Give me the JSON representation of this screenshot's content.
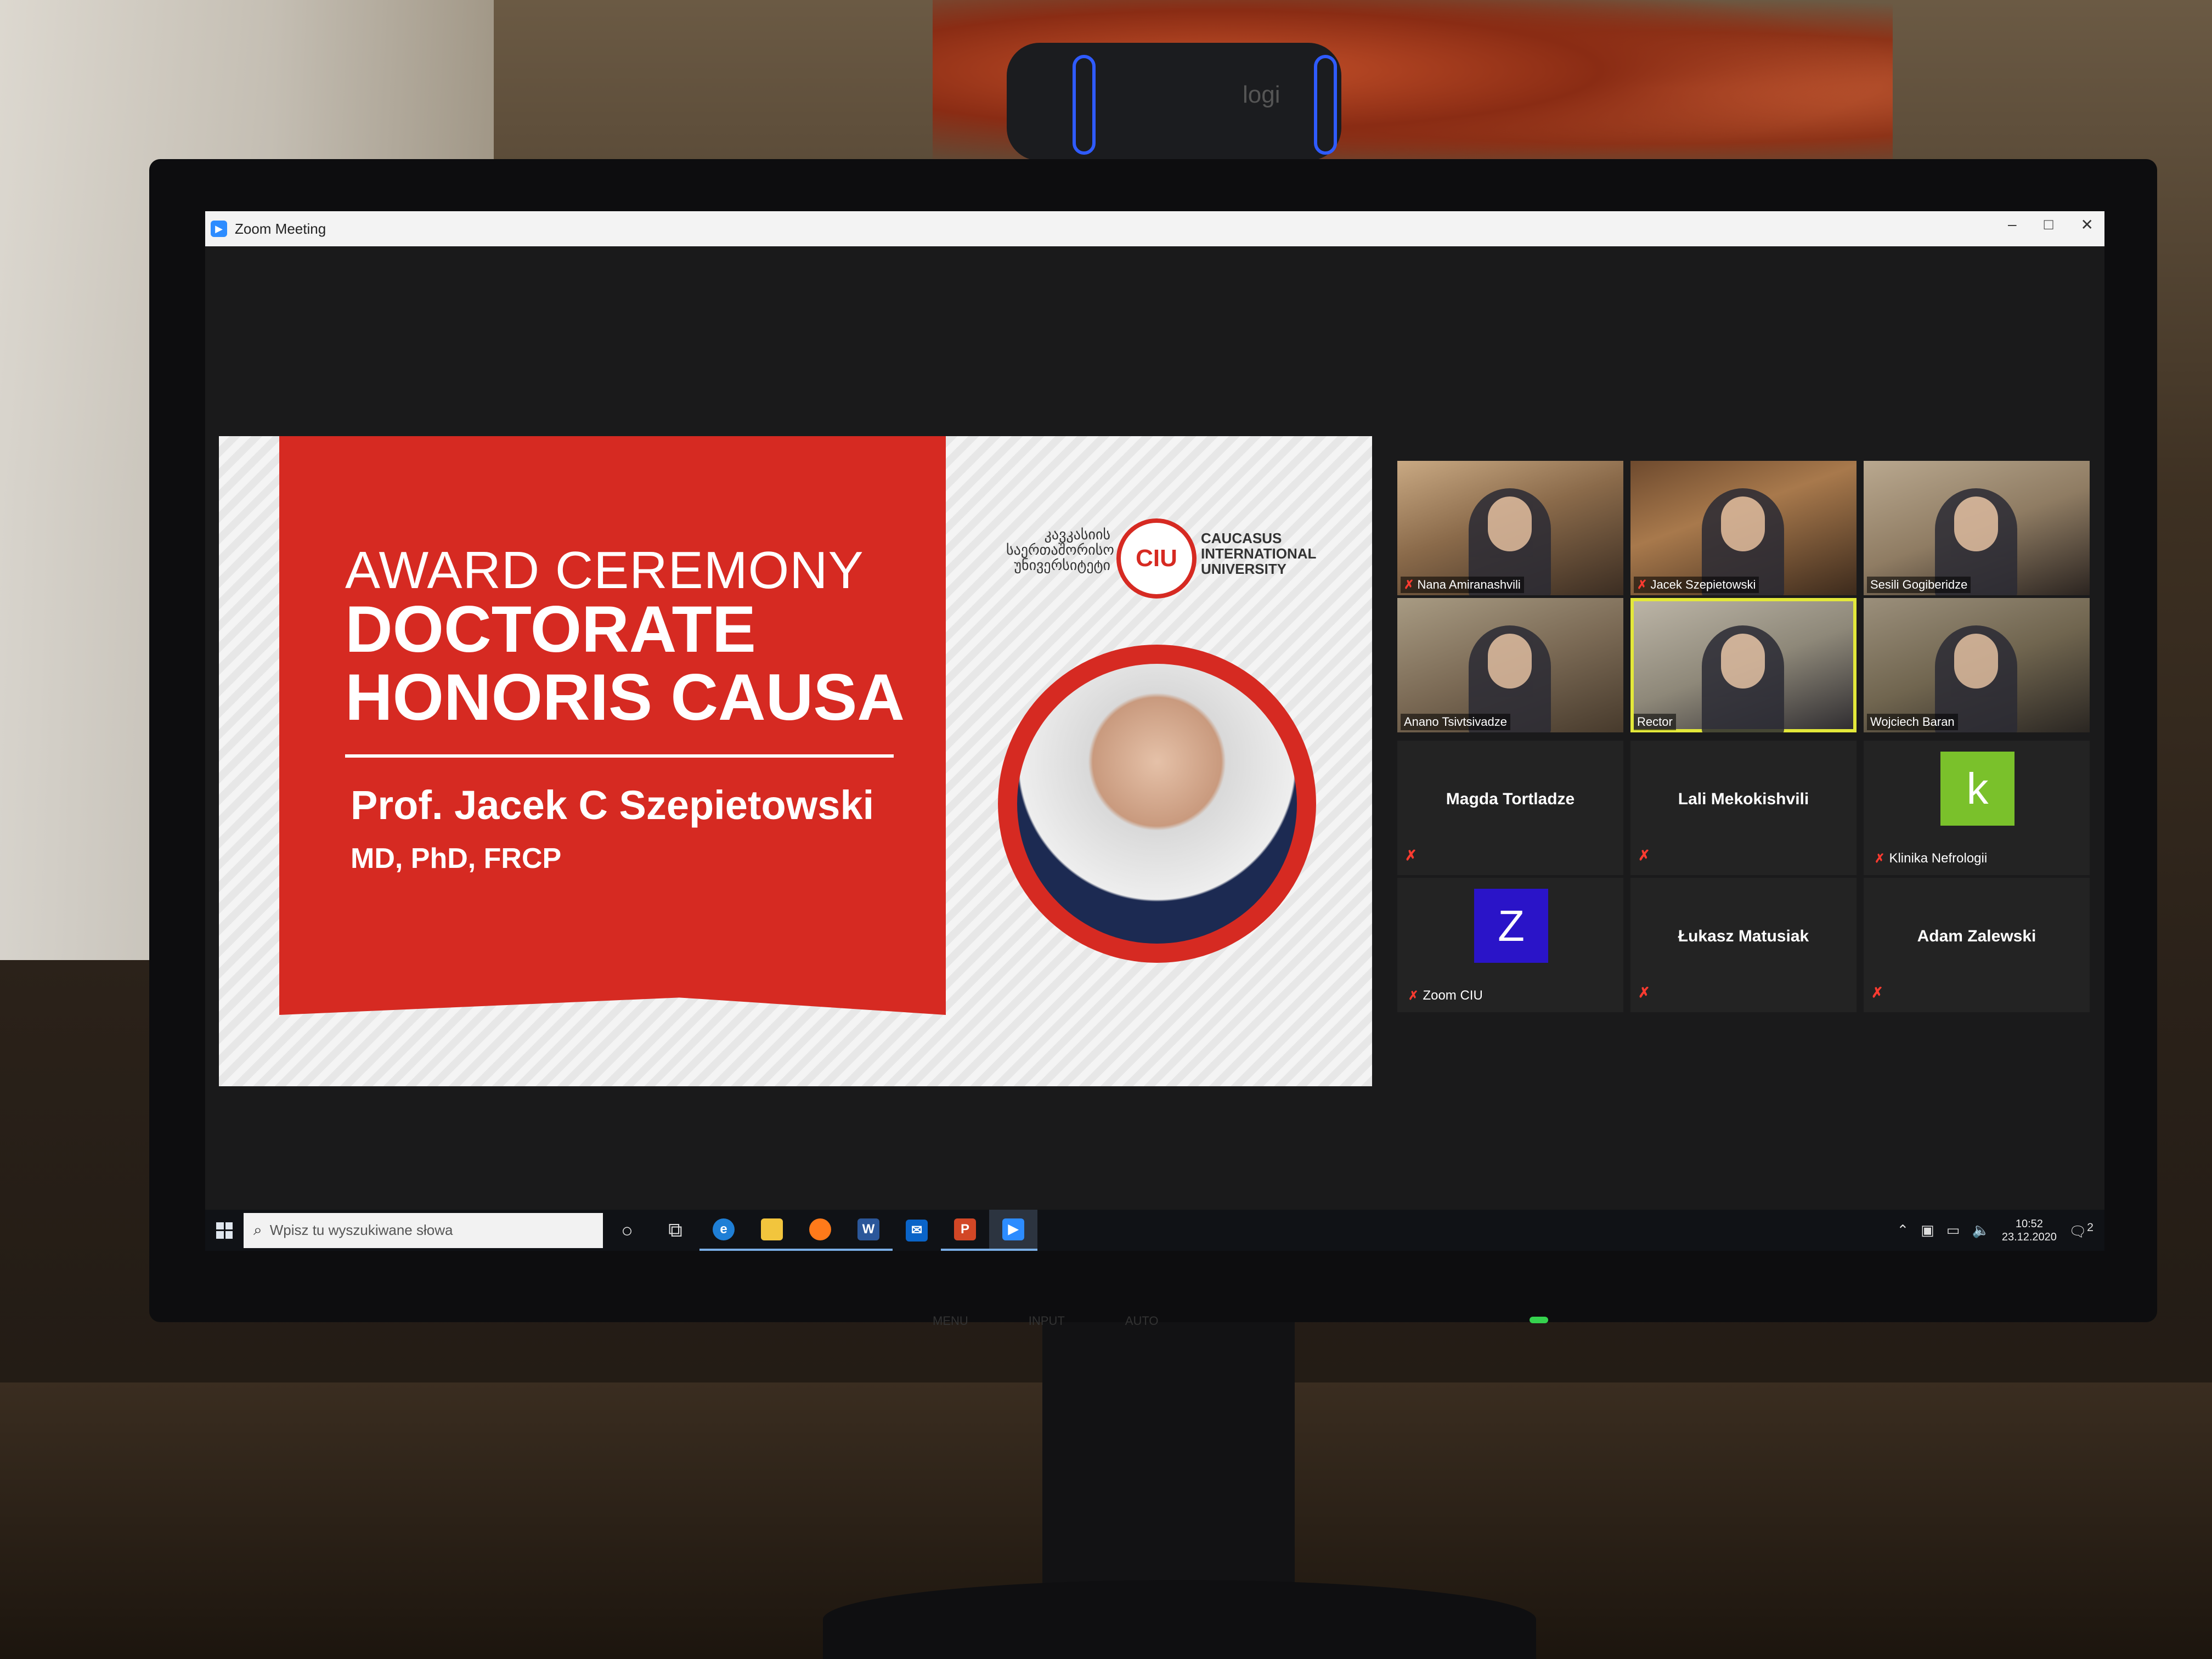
{
  "window": {
    "title": "Zoom Meeting",
    "controls": [
      "–",
      "□",
      "✕"
    ]
  },
  "slide": {
    "line1": "AWARD CEREMONY",
    "line2": "DOCTORATE",
    "line3": "HONORIS CAUSA",
    "name": "Prof. Jacek C Szepietowski",
    "degrees": "MD, PhD, FRCP",
    "logo_geo": [
      "კავკასიის",
      "საერთაშორისო",
      "უნივერსიტეტი"
    ],
    "logo_seal": "CIU",
    "logo_en": [
      "CAUCASUS",
      "INTERNATIONAL",
      "UNIVERSITY"
    ],
    "colors": {
      "red": "#d62a22"
    }
  },
  "participants": [
    {
      "name": "Nana Amiranashvili",
      "video": true,
      "muted": true
    },
    {
      "name": "Jacek Szepietowski",
      "video": true,
      "muted": true
    },
    {
      "name": "Sesili Gogiberidze",
      "video": true,
      "muted": false
    },
    {
      "name": "Anano Tsivtsivadze",
      "video": true,
      "muted": false
    },
    {
      "name": "Rector",
      "video": true,
      "muted": false,
      "active_speaker": true
    },
    {
      "name": "Wojciech Baran",
      "video": true,
      "muted": false
    },
    {
      "name": "Magda Tortladze",
      "video": false,
      "muted": true
    },
    {
      "name": "Lali Mekokishvili",
      "video": false,
      "muted": true
    },
    {
      "name": "Klinika Nefrologii",
      "video": false,
      "muted": true,
      "avatar_letter": "k",
      "avatar_color": "#7ac12b"
    },
    {
      "name": "Zoom CIU",
      "video": false,
      "muted": true,
      "avatar_letter": "Z",
      "avatar_color": "#2a14c8"
    },
    {
      "name": "Łukasz Matusiak",
      "video": false,
      "muted": true
    },
    {
      "name": "Adam Zalewski",
      "video": false,
      "muted": true
    }
  ],
  "taskbar": {
    "search_placeholder": "Wpisz tu wyszukiwane słowa",
    "apps": [
      "cortana-icon",
      "task-view-icon",
      "edge-icon",
      "file-explorer-icon",
      "firefox-icon",
      "word-icon",
      "mail-icon",
      "powerpoint-icon",
      "zoom-icon"
    ],
    "time": "10:52",
    "date": "23.12.2020",
    "notifications": "2"
  },
  "hardware": {
    "webcam_brand": "logi",
    "bezel_labels": [
      "MENU",
      "",
      "INPUT",
      "",
      "",
      "AUTO"
    ]
  }
}
